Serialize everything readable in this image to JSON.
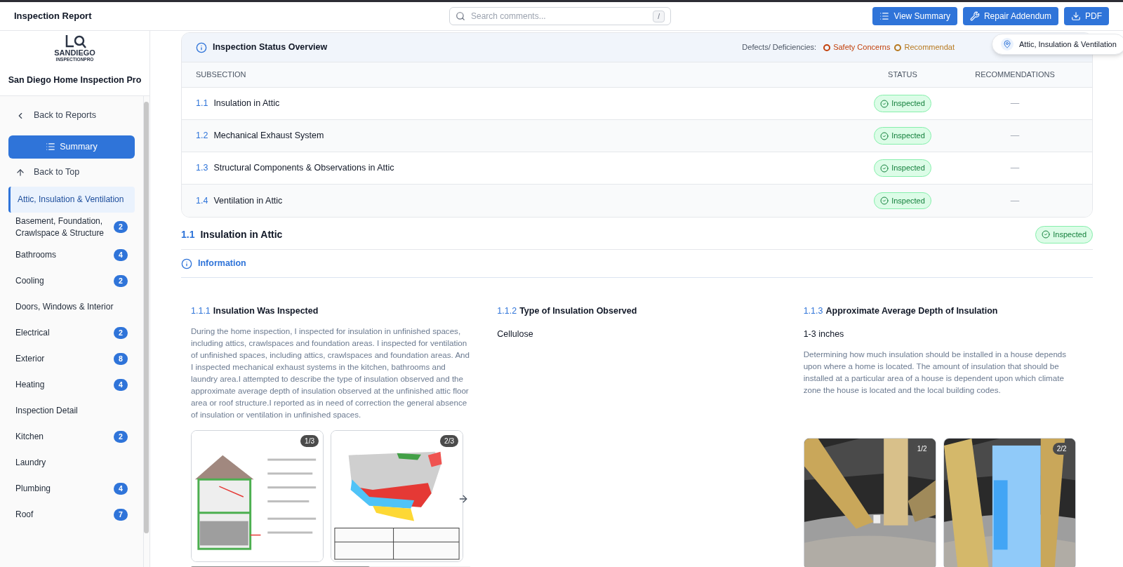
{
  "header": {
    "title": "Inspection Report",
    "search": {
      "placeholder": "Search comments...",
      "shortcut": "/"
    },
    "buttons": [
      {
        "label": "View Summary"
      },
      {
        "label": "Repair Addendum"
      },
      {
        "label": "PDF"
      }
    ]
  },
  "sidebar": {
    "logo_lines": [
      "SANDIEGO",
      "INSPECTIONPRO"
    ],
    "company": "San Diego Home Inspection Pro",
    "back": "Back to Reports",
    "summary": "Summary",
    "top": "Back to Top",
    "items": [
      {
        "label": "Attic, Insulation & Ventilation",
        "selected": true
      },
      {
        "label": "Basement, Foundation, Crawlspace & Structure",
        "count": "2",
        "selected": false
      },
      {
        "label": "Bathrooms",
        "count": "4",
        "selected": false
      },
      {
        "label": "Cooling",
        "count": "2",
        "selected": false
      },
      {
        "label": "Doors, Windows & Interior",
        "selected": false
      },
      {
        "label": "Electrical",
        "count": "2",
        "selected": false
      },
      {
        "label": "Exterior",
        "count": "8",
        "selected": false
      },
      {
        "label": "Heating",
        "count": "4",
        "selected": false
      },
      {
        "label": "Inspection Detail",
        "selected": false
      },
      {
        "label": "Kitchen",
        "count": "2",
        "selected": false
      },
      {
        "label": "Laundry",
        "selected": false
      },
      {
        "label": "Plumbing",
        "count": "4",
        "selected": false
      },
      {
        "label": "Roof",
        "count": "7",
        "selected": false
      }
    ]
  },
  "location_pill": "Attic, Insulation & Ventilation",
  "overview": {
    "title": "Inspection Status Overview",
    "legend_label": "Defects/ Deficiencies:",
    "legend": [
      {
        "label": "Safety Concerns",
        "color": "#c2410c"
      },
      {
        "label": "Recommendat",
        "color": "#b7791f"
      }
    ],
    "columns": [
      "SUBSECTION",
      "STATUS",
      "RECOMMENDATIONS"
    ],
    "rows": [
      {
        "number": "1.1",
        "name": "Insulation in Attic",
        "status": "Inspected",
        "recommendations": "—"
      },
      {
        "number": "1.2",
        "name": "Mechanical Exhaust System",
        "status": "Inspected",
        "recommendations": "—"
      },
      {
        "number": "1.3",
        "name": "Structural Components & Observations in Attic",
        "status": "Inspected",
        "recommendations": "—"
      },
      {
        "number": "1.4",
        "name": "Ventilation in Attic",
        "status": "Inspected",
        "recommendations": "—"
      }
    ]
  },
  "section": {
    "number": "1.1",
    "title": "Insulation in Attic",
    "status": "Inspected",
    "tab": "Information",
    "items": [
      {
        "number": "1.1.1",
        "title": "Insulation Was Inspected",
        "text": "During the home inspection, I inspected for insulation in unfinished spaces, including attics, crawlspaces and foundation areas. I inspected for ventilation of unfinished spaces, including attics, crawlspaces and foundation areas. And I inspected mechanical exhaust systems in the kitchen, bathrooms and laundry area.I attempted to describe the type of insulation observed and the approximate average depth of insulation observed at the unfinished attic floor area or roof structure.I reported as in need of correction the general absence of insulation or ventilation in unfinished spaces.",
        "images": [
          {
            "kind": "diagram",
            "counter": "1/3"
          },
          {
            "kind": "map",
            "counter": "2/3"
          }
        ],
        "more": true
      },
      {
        "number": "1.1.2",
        "title": "Type of Insulation Observed",
        "value": "Cellulose"
      },
      {
        "number": "1.1.3",
        "title": "Approximate Average Depth of Insulation",
        "value": "1-3 inches",
        "text": "Determining how much insulation should be installed in a house depends upon where a home is located. The amount of insulation that should be installed at a particular area of a house is dependent upon which climate zone the house is located and the local building codes.",
        "images": [
          {
            "counter": "1/2"
          },
          {
            "counter": "2/2"
          }
        ]
      }
    ]
  }
}
